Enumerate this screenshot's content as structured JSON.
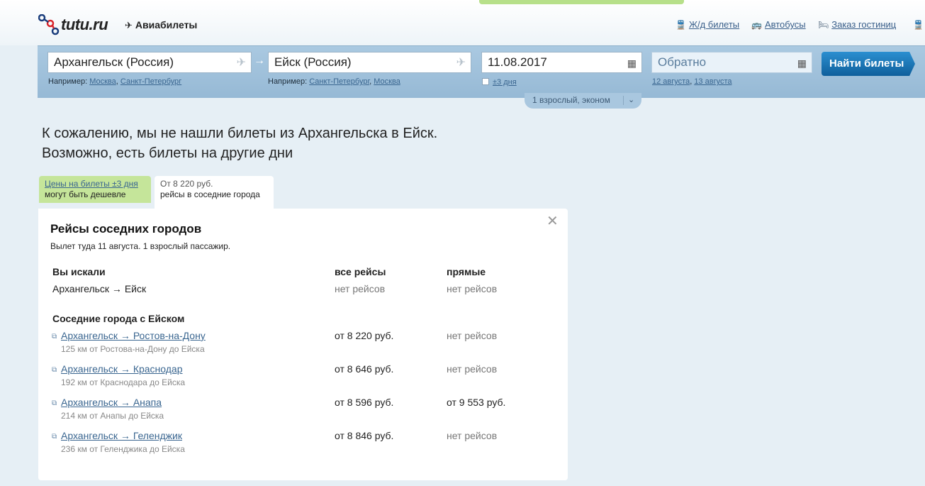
{
  "header": {
    "logo_text": "tutu.ru",
    "section": "Авиабилеты",
    "nav": [
      {
        "icon": "train-icon",
        "label": "Ж/д билеты"
      },
      {
        "icon": "bus-icon",
        "label": "Автобусы"
      },
      {
        "icon": "bed-icon",
        "label": "Заказ гостиниц"
      }
    ]
  },
  "search": {
    "from": "Архангельск (Россия)",
    "to": "Ейск (Россия)",
    "date": "11.08.2017",
    "return_placeholder": "Обратно",
    "hint_prefix": "Например:",
    "from_examples": [
      "Москва",
      "Санкт-Петербург"
    ],
    "to_examples": [
      "Санкт-Петербург",
      "Москва"
    ],
    "flex_days": "±3 дня",
    "return_examples": [
      "12 августа",
      "13 августа"
    ],
    "find_button": "Найти билеты",
    "passengers": "1 взрослый, эконом"
  },
  "message": {
    "line1": "К сожалению, мы не нашли билеты из Архангельска в Ейск.",
    "line2": "Возможно, есть билеты на другие дни"
  },
  "tabs": [
    {
      "line1": "Цены на билеты ±3 дня",
      "line2": "могут быть дешевле"
    },
    {
      "line1": "От 8 220 руб.",
      "line2": "рейсы в соседние города"
    }
  ],
  "card": {
    "title": "Рейсы соседних городов",
    "subtitle": "Вылет туда 11 августа. 1 взрослый пассажир.",
    "col_searched": "Вы искали",
    "col_all": "все рейсы",
    "col_direct": "прямые",
    "searched_route": "Архангельск → Ейск",
    "searched_all": "нет рейсов",
    "searched_direct": "нет рейсов",
    "nearby_heading": "Соседние города с Ейском",
    "routes": [
      {
        "route": "Архангельск → Ростов-на-Дону",
        "distance": "125 км от Ростова-на-Дону до Ейска",
        "all": "от 8 220 руб.",
        "direct": "нет рейсов"
      },
      {
        "route": "Архангельск → Краснодар",
        "distance": "192 км от Краснодара до Ейска",
        "all": "от 8 646 руб.",
        "direct": "нет рейсов"
      },
      {
        "route": "Архангельск → Анапа",
        "distance": "214 км от Анапы до Ейска",
        "all": "от 8 596 руб.",
        "direct": "от 9 553 руб."
      },
      {
        "route": "Архангельск → Геленджик",
        "distance": "236 км от Геленджика до Ейска",
        "all": "от 8 846 руб.",
        "direct": "нет рейсов"
      }
    ]
  },
  "colors": {
    "panel": "#9fc1dc",
    "button": "#1a74b8",
    "tab_green": "#c5e59a",
    "link": "#3a6690"
  }
}
